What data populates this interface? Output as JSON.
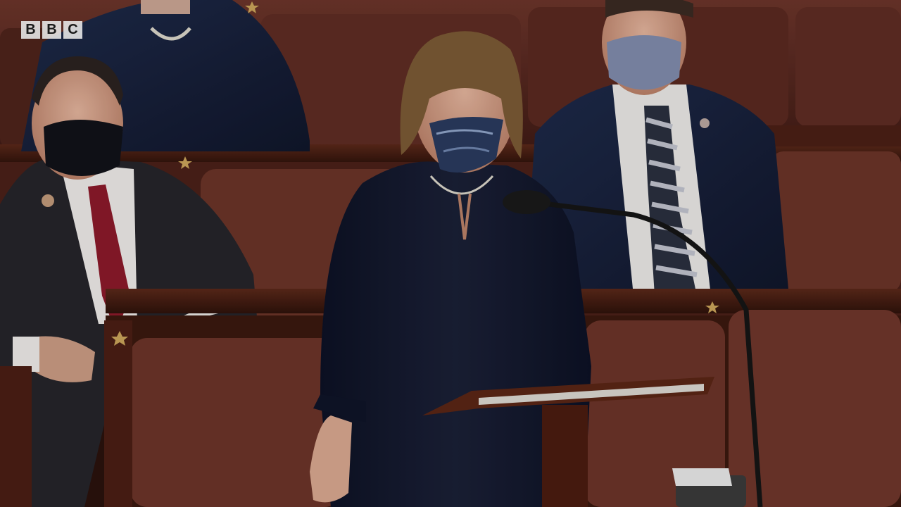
{
  "logo": {
    "letters": [
      "B",
      "B",
      "C"
    ]
  },
  "colors": {
    "leather": "#5a2a22",
    "wood": "#3d1a12",
    "suit_navy": "#161d33",
    "shirt_white": "#e8e6e3",
    "tie_red": "#8a1a2a"
  }
}
